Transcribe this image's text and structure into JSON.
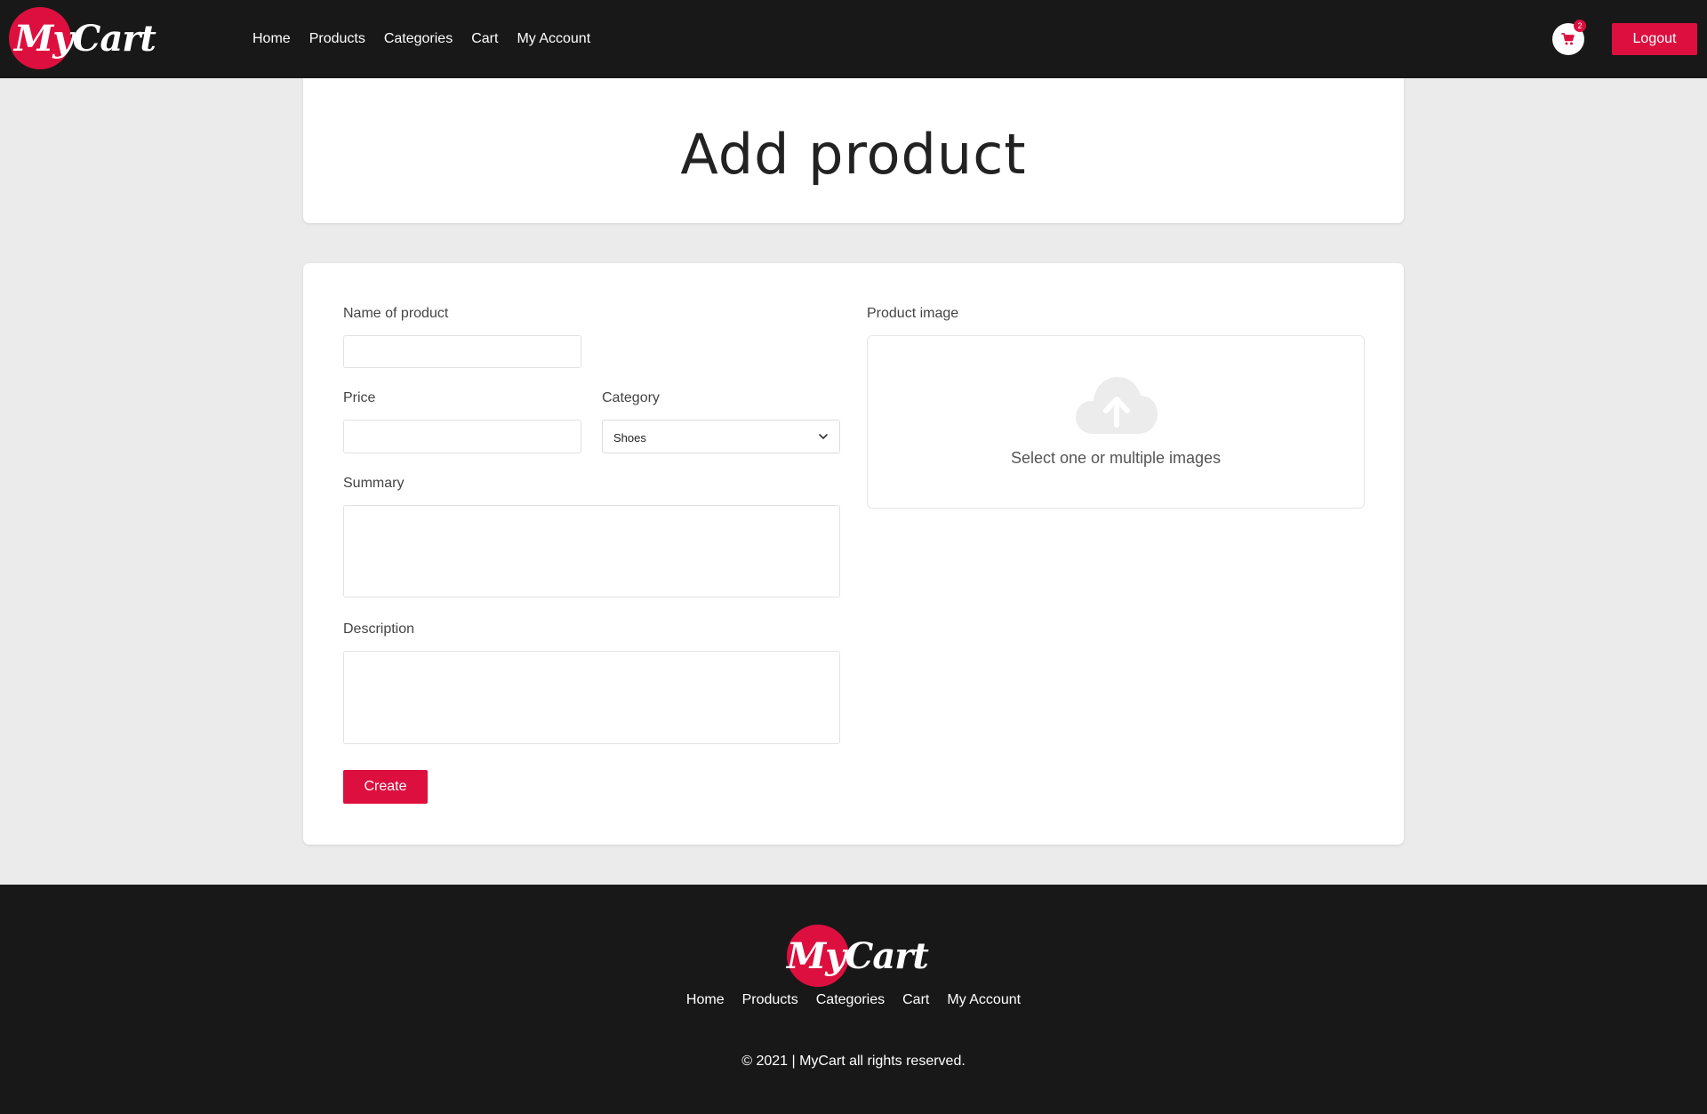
{
  "brand": {
    "name": "MyCart",
    "accent_color": "#dd0f3f",
    "bar_color": "#181818"
  },
  "header": {
    "nav": [
      "Home",
      "Products",
      "Categories",
      "Cart",
      "My Account"
    ],
    "cart_icon": "shopping-cart-icon",
    "cart_count": "2",
    "logout_label": "Logout"
  },
  "page": {
    "title": "Add product"
  },
  "form": {
    "name_label": "Name of product",
    "name_value": "",
    "price_label": "Price",
    "price_value": "",
    "category_label": "Category",
    "category_value": "Shoes",
    "summary_label": "Summary",
    "summary_value": "",
    "description_label": "Description",
    "description_value": "",
    "image_label": "Product image",
    "upload_icon": "cloud-upload-icon",
    "upload_hint": "Select one or multiple images",
    "submit_label": "Create"
  },
  "footer": {
    "nav": [
      "Home",
      "Products",
      "Categories",
      "Cart",
      "My Account"
    ],
    "copyright": "© 2021 | MyCart all rights reserved."
  }
}
